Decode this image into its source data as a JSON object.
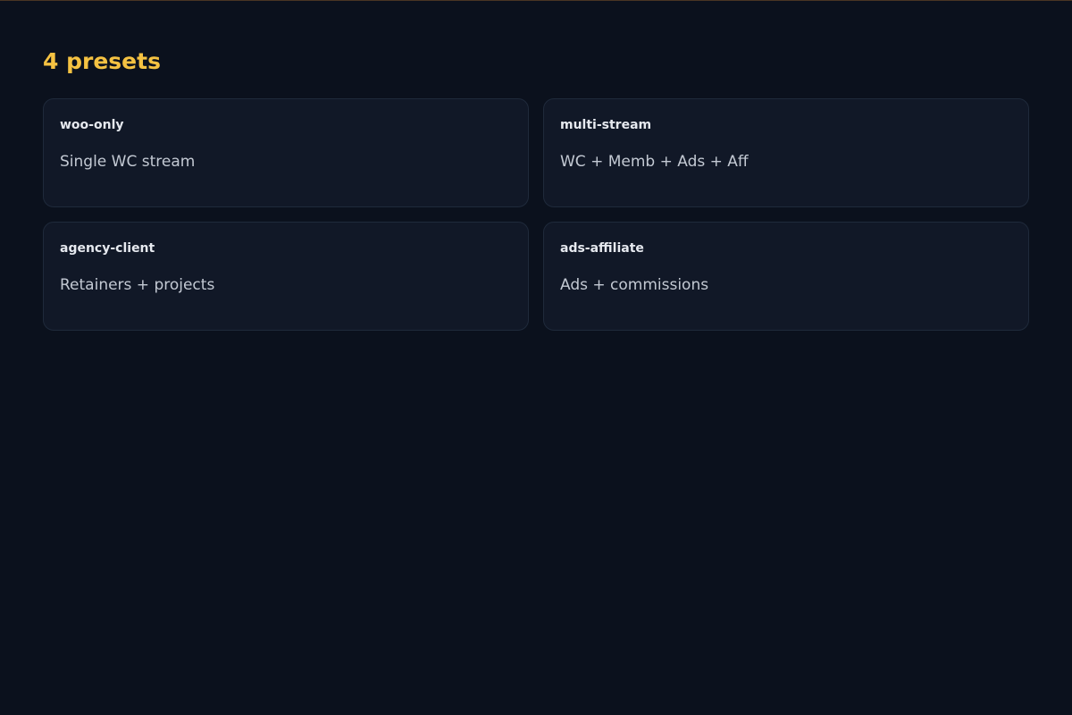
{
  "theme": {
    "background": "#0b111d",
    "card_background": "#111827",
    "card_border": "#1f2a3b",
    "accent": "#f5c242",
    "name_color": "#e6e9ef",
    "desc_color": "#c3c9d3"
  },
  "header": {
    "title": "4 presets"
  },
  "presets": [
    {
      "name": "woo-only",
      "description": "Single WC stream"
    },
    {
      "name": "multi-stream",
      "description": "WC + Memb + Ads + Aff"
    },
    {
      "name": "agency-client",
      "description": "Retainers + projects"
    },
    {
      "name": "ads-affiliate",
      "description": "Ads + commissions"
    }
  ]
}
